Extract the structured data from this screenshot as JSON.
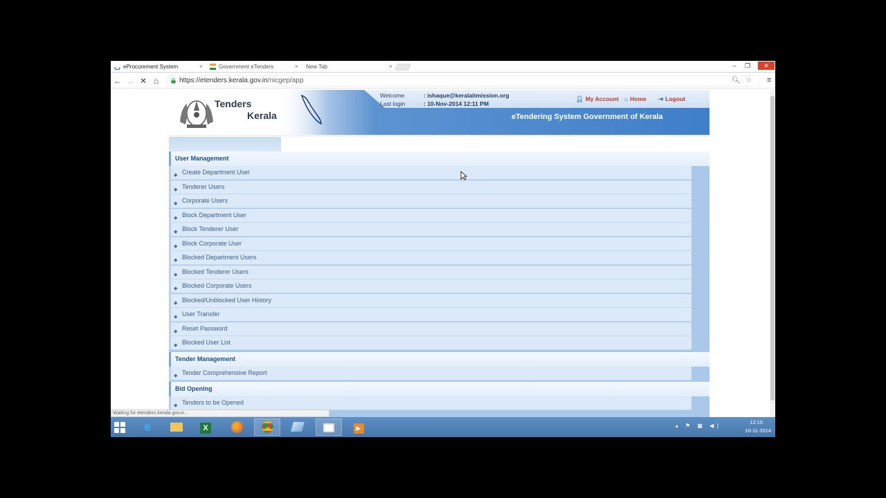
{
  "browser": {
    "tabs": [
      {
        "title": "eProcurement System",
        "active": true
      },
      {
        "title": "Government eTenders",
        "active": false
      },
      {
        "title": "New Tab",
        "active": false
      }
    ],
    "close_glyph": "×",
    "url_host": "https://etenders.kerala.gov.in",
    "url_path": "/nicgep/app",
    "status_text": "Waiting for etenders.kerala.gov.in..."
  },
  "site": {
    "logo_line1": "Tenders",
    "logo_line2": "Kerala",
    "welcome_label": "Welcome",
    "welcome_value": ": ishaque@keralaitmission.org",
    "last_login_label": "Last login",
    "last_login_value": ":  10-Nov-2014 12:11 PM",
    "links": {
      "my_account": "My Account",
      "home": "Home",
      "logout": "Logout"
    },
    "title": "eTendering System Government of Kerala",
    "accent_color": "#3f7fca",
    "link_color": "#c0392b"
  },
  "menu": {
    "user_management": {
      "heading": "User Management",
      "items": [
        "Create Department User",
        "Tenderer Users",
        "Corporate Users",
        "Block Department User",
        "Block Tenderer User",
        "Block Corporate User",
        "Blocked Department Users",
        "Blocked Tenderer Users",
        "Blocked Corporate Users",
        "Blocked/Unblocked User History",
        "User Transfer",
        "Reset Password",
        "Blocked User List"
      ]
    },
    "tender_management": {
      "heading": "Tender Management",
      "items": [
        "Tender Comprehensive Report"
      ]
    },
    "bid_opening": {
      "heading": "Bid Opening",
      "items": [
        "Tenders to be Opened"
      ]
    }
  },
  "taskbar": {
    "apps": [
      "start-icon",
      "internet-explorer-icon",
      "file-explorer-icon",
      "excel-icon",
      "firefox-icon",
      "chrome-icon",
      "app-icon",
      "window-icon",
      "media-player-icon"
    ],
    "time": "12:15",
    "date": "10-11-2014"
  }
}
